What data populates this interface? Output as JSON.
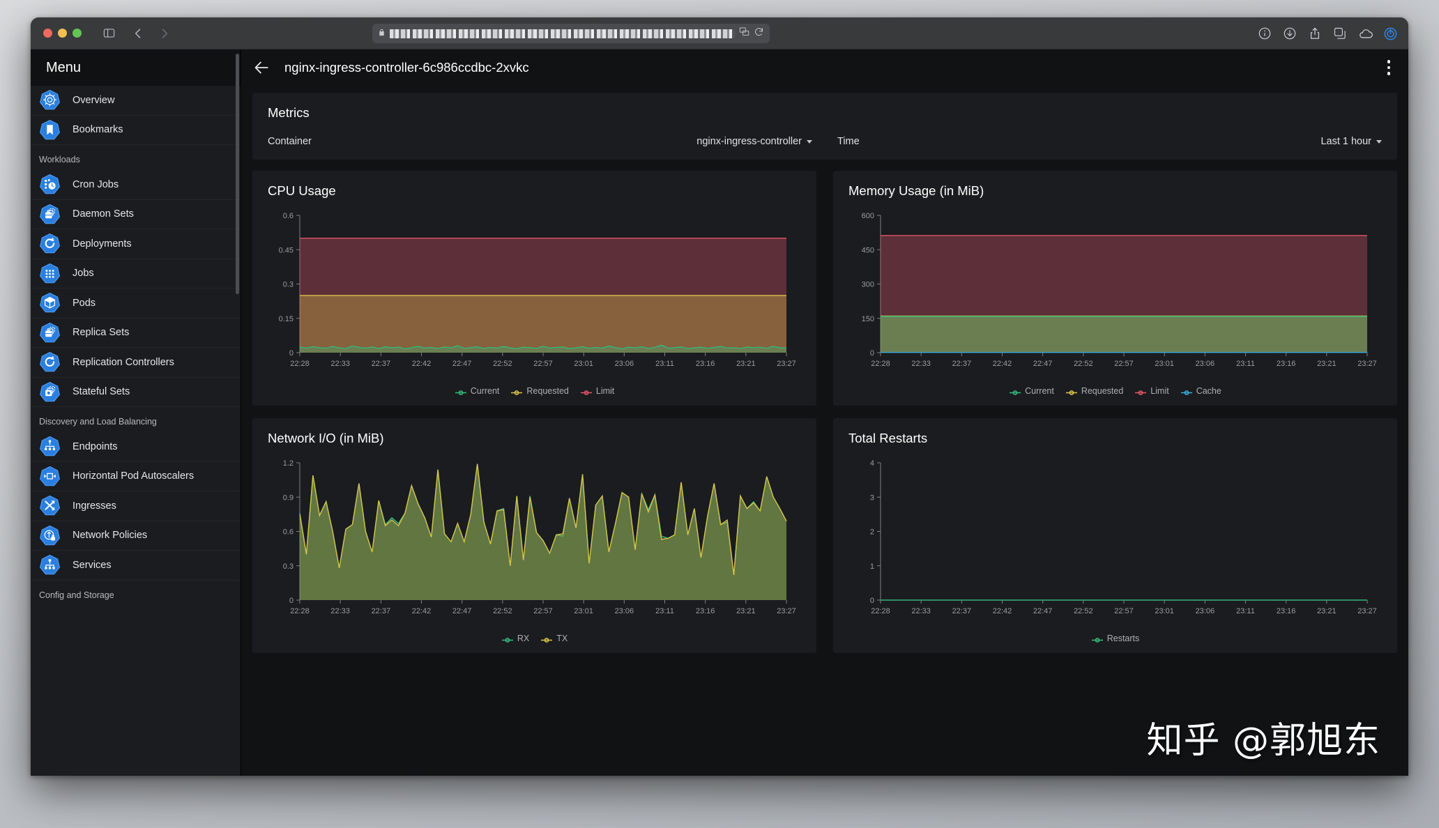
{
  "browser": {
    "url_redacted": true,
    "lock_icon": "lock-icon",
    "toolbar_icons": [
      "sidebar-icon",
      "back-icon",
      "forward-icon",
      "translate-icon",
      "reload-icon",
      "info-icon",
      "download-icon",
      "share-icon",
      "tabs-icon",
      "icloud-icon",
      "extension-icon"
    ]
  },
  "sidebar": {
    "title": "Menu",
    "items": [
      {
        "label": "Overview",
        "icon": "kubernetes-overview-icon",
        "type": "item"
      },
      {
        "label": "Bookmarks",
        "icon": "bookmark-icon",
        "type": "item"
      },
      {
        "label": "Workloads",
        "type": "section"
      },
      {
        "label": "Cron Jobs",
        "icon": "cronjob-icon",
        "type": "item"
      },
      {
        "label": "Daemon Sets",
        "icon": "daemonset-icon",
        "type": "item"
      },
      {
        "label": "Deployments",
        "icon": "deployment-icon",
        "type": "item"
      },
      {
        "label": "Jobs",
        "icon": "job-icon",
        "type": "item"
      },
      {
        "label": "Pods",
        "icon": "pod-icon",
        "type": "item"
      },
      {
        "label": "Replica Sets",
        "icon": "replicaset-icon",
        "type": "item"
      },
      {
        "label": "Replication Controllers",
        "icon": "replicationcontroller-icon",
        "type": "item"
      },
      {
        "label": "Stateful Sets",
        "icon": "statefulset-icon",
        "type": "item"
      },
      {
        "label": "Discovery and Load Balancing",
        "type": "section"
      },
      {
        "label": "Endpoints",
        "icon": "endpoint-icon",
        "type": "item"
      },
      {
        "label": "Horizontal Pod Autoscalers",
        "icon": "hpa-icon",
        "type": "item"
      },
      {
        "label": "Ingresses",
        "icon": "ingress-icon",
        "type": "item"
      },
      {
        "label": "Network Policies",
        "icon": "networkpolicy-icon",
        "type": "item"
      },
      {
        "label": "Services",
        "icon": "service-icon",
        "type": "item"
      },
      {
        "label": "Config and Storage",
        "type": "section"
      }
    ]
  },
  "header": {
    "back_icon": "back-arrow-icon",
    "title": "nginx-ingress-controller-6c986ccdbc-2xvkc",
    "menu_icon": "vertical-dots-icon"
  },
  "metrics_panel": {
    "title": "Metrics",
    "container_label": "Container",
    "container_value": "nginx-ingress-controller",
    "time_label": "Time",
    "time_value": "Last 1 hour"
  },
  "colors": {
    "current": "#34b67a",
    "requested": "#d8c04a",
    "limit": "#e05569",
    "cache": "#38a8d8",
    "rx": "#34b67a",
    "tx": "#d8c04a",
    "restarts": "#34b67a",
    "panel_bg": "#1a1c1f",
    "page_bg": "#111214"
  },
  "chart_data": [
    {
      "type": "area",
      "title": "CPU Usage",
      "xlabel": "",
      "ylabel": "",
      "ylim": [
        0,
        0.6
      ],
      "yticks": [
        0,
        0.15,
        0.3,
        0.45,
        0.6
      ],
      "ytick_labels": [
        "0",
        "0.15",
        "0.3",
        "0.45",
        "0.6"
      ],
      "x": [
        "22:28",
        "22:33",
        "22:37",
        "22:42",
        "22:47",
        "22:52",
        "22:57",
        "23:01",
        "23:06",
        "23:11",
        "23:16",
        "23:21",
        "23:27"
      ],
      "grid": false,
      "legend": [
        "Current",
        "Requested",
        "Limit"
      ],
      "legend_position": "bottom",
      "series": [
        {
          "name": "Limit",
          "constant": 0.5,
          "color": "#e05569"
        },
        {
          "name": "Requested",
          "constant": 0.25,
          "color": "#d8c04a"
        },
        {
          "name": "Current",
          "color": "#34b67a",
          "values": [
            0.024,
            0.02,
            0.026,
            0.022,
            0.019,
            0.027,
            0.021,
            0.018,
            0.029,
            0.023,
            0.02,
            0.025,
            0.018,
            0.026,
            0.021,
            0.024,
            0.017,
            0.022,
            0.028,
            0.02,
            0.023,
            0.018,
            0.025,
            0.021,
            0.03,
            0.019,
            0.022,
            0.026,
            0.018,
            0.023,
            0.02,
            0.027,
            0.021,
            0.017,
            0.024,
            0.022,
            0.019,
            0.028,
            0.02,
            0.023,
            0.025,
            0.018,
            0.021,
            0.026,
            0.019,
            0.023,
            0.02,
            0.029,
            0.022,
            0.017,
            0.024,
            0.021,
            0.026,
            0.018,
            0.023,
            0.033,
            0.02,
            0.022,
            0.025,
            0.018,
            0.021,
            0.024,
            0.019,
            0.023,
            0.027,
            0.02,
            0.022,
            0.018,
            0.025,
            0.021,
            0.024,
            0.019,
            0.028,
            0.022,
            0.02
          ]
        }
      ]
    },
    {
      "type": "area",
      "title": "Memory Usage (in MiB)",
      "xlabel": "",
      "ylabel": "",
      "ylim": [
        0,
        600
      ],
      "yticks": [
        0,
        150,
        300,
        450,
        600
      ],
      "ytick_labels": [
        "0",
        "150",
        "300",
        "450",
        "600"
      ],
      "x": [
        "22:28",
        "22:33",
        "22:37",
        "22:42",
        "22:47",
        "22:52",
        "22:57",
        "23:01",
        "23:06",
        "23:11",
        "23:16",
        "23:21",
        "23:27"
      ],
      "grid": false,
      "legend": [
        "Current",
        "Requested",
        "Limit",
        "Cache"
      ],
      "legend_position": "bottom",
      "series": [
        {
          "name": "Limit",
          "constant": 512,
          "color": "#e05569"
        },
        {
          "name": "Requested",
          "constant": 160,
          "color": "#d8c04a"
        },
        {
          "name": "Current",
          "constant": 158,
          "color": "#34b67a"
        },
        {
          "name": "Cache",
          "constant": 1,
          "color": "#38a8d8"
        }
      ]
    },
    {
      "type": "area",
      "title": "Network I/O (in MiB)",
      "xlabel": "",
      "ylabel": "",
      "ylim": [
        0,
        1.2
      ],
      "yticks": [
        0,
        0.3,
        0.6,
        0.9,
        1.2
      ],
      "ytick_labels": [
        "0",
        "0.3",
        "0.6",
        "0.9",
        "1.2"
      ],
      "x": [
        "22:28",
        "22:33",
        "22:37",
        "22:42",
        "22:47",
        "22:52",
        "22:57",
        "23:01",
        "23:06",
        "23:11",
        "23:16",
        "23:21",
        "23:27"
      ],
      "grid": false,
      "legend": [
        "RX",
        "TX"
      ],
      "legend_position": "bottom",
      "series": [
        {
          "name": "RX",
          "color": "#34b67a",
          "values": [
            0.76,
            0.4,
            1.09,
            0.74,
            0.86,
            0.6,
            0.28,
            0.62,
            0.66,
            1.02,
            0.6,
            0.42,
            0.87,
            0.66,
            0.72,
            0.67,
            0.76,
            1.0,
            0.84,
            0.72,
            0.55,
            1.14,
            0.58,
            0.51,
            0.67,
            0.51,
            0.75,
            1.19,
            0.68,
            0.49,
            0.78,
            0.8,
            0.3,
            0.91,
            0.35,
            0.91,
            0.59,
            0.52,
            0.41,
            0.57,
            0.56,
            0.89,
            0.63,
            1.1,
            0.32,
            0.83,
            0.91,
            0.42,
            0.67,
            0.94,
            0.9,
            0.44,
            0.93,
            0.79,
            0.92,
            0.56,
            0.54,
            0.57,
            1.03,
            0.57,
            0.8,
            0.37,
            0.73,
            1.02,
            0.66,
            0.68,
            0.22,
            0.91,
            0.8,
            0.86,
            0.78,
            1.08,
            0.9,
            0.8,
            0.69
          ]
        },
        {
          "name": "TX",
          "color": "#d8c04a",
          "values": [
            0.75,
            0.4,
            1.09,
            0.74,
            0.86,
            0.6,
            0.28,
            0.62,
            0.66,
            1.02,
            0.6,
            0.42,
            0.87,
            0.65,
            0.7,
            0.65,
            0.76,
            1.0,
            0.84,
            0.72,
            0.55,
            1.14,
            0.58,
            0.51,
            0.67,
            0.51,
            0.75,
            1.19,
            0.68,
            0.49,
            0.78,
            0.79,
            0.3,
            0.91,
            0.35,
            0.9,
            0.59,
            0.52,
            0.41,
            0.57,
            0.58,
            0.89,
            0.63,
            1.1,
            0.32,
            0.83,
            0.91,
            0.42,
            0.67,
            0.94,
            0.9,
            0.44,
            0.93,
            0.77,
            0.92,
            0.53,
            0.54,
            0.57,
            1.03,
            0.57,
            0.8,
            0.37,
            0.73,
            1.02,
            0.66,
            0.7,
            0.22,
            0.91,
            0.8,
            0.85,
            0.78,
            1.08,
            0.9,
            0.8,
            0.69
          ]
        }
      ]
    },
    {
      "type": "line",
      "title": "Total Restarts",
      "xlabel": "",
      "ylabel": "",
      "ylim": [
        0,
        4
      ],
      "yticks": [
        0,
        1,
        2,
        3,
        4
      ],
      "ytick_labels": [
        "0",
        "1",
        "2",
        "3",
        "4"
      ],
      "x": [
        "22:28",
        "22:33",
        "22:37",
        "22:42",
        "22:47",
        "22:52",
        "22:57",
        "23:01",
        "23:06",
        "23:11",
        "23:16",
        "23:21",
        "23:27"
      ],
      "grid": false,
      "legend": [
        "Restarts"
      ],
      "legend_position": "bottom",
      "series": [
        {
          "name": "Restarts",
          "constant": 0,
          "color": "#34b67a"
        }
      ]
    }
  ],
  "watermark": "知乎 @郭旭东"
}
